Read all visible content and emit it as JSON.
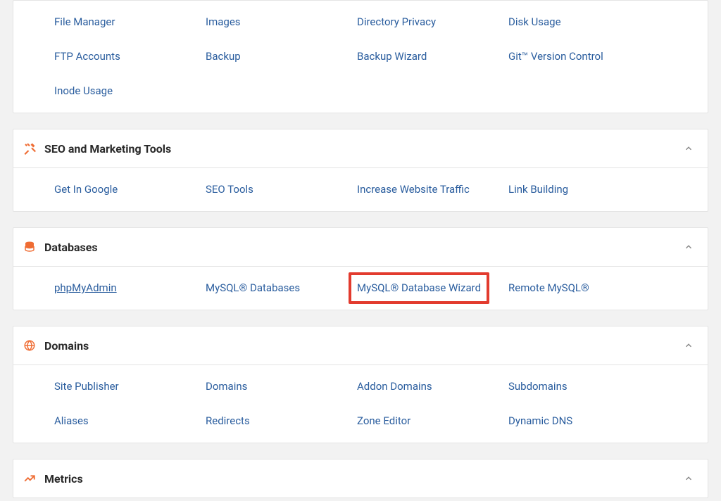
{
  "colors": {
    "icon_accent": "#ef6c33",
    "link": "#2a5d9e",
    "highlight_border": "#e23b2e"
  },
  "panels": [
    {
      "id": "files",
      "title": "",
      "icon": "",
      "show_header": false,
      "links": [
        "File Manager",
        "Images",
        "Directory Privacy",
        "Disk Usage",
        "FTP Accounts",
        "Backup",
        "Backup Wizard",
        "Git™ Version Control",
        "Inode Usage"
      ]
    },
    {
      "id": "seo",
      "title": "SEO and Marketing Tools",
      "icon": "tools-icon",
      "show_header": true,
      "links": [
        "Get In Google",
        "SEO Tools",
        "Increase Website Traffic",
        "Link Building"
      ]
    },
    {
      "id": "databases",
      "title": "Databases",
      "icon": "database-icon",
      "show_header": true,
      "links": [
        "phpMyAdmin",
        "MySQL® Databases",
        "MySQL® Database Wizard",
        "Remote MySQL®"
      ],
      "underline_index": 0,
      "highlight_index": 2
    },
    {
      "id": "domains",
      "title": "Domains",
      "icon": "globe-icon",
      "show_header": true,
      "links": [
        "Site Publisher",
        "Domains",
        "Addon Domains",
        "Subdomains",
        "Aliases",
        "Redirects",
        "Zone Editor",
        "Dynamic DNS"
      ]
    },
    {
      "id": "metrics",
      "title": "Metrics",
      "icon": "chart-icon",
      "show_header": true,
      "links": []
    }
  ]
}
